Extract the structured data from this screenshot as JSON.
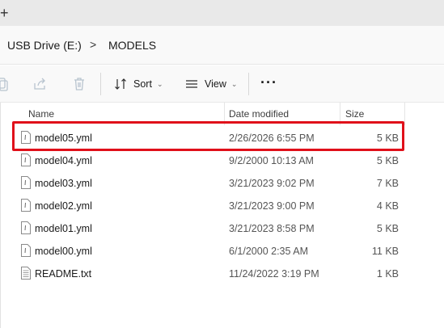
{
  "titlebar": {
    "new_tab_symbol": "+"
  },
  "address": {
    "crumbs": [
      "USB Drive (E:)",
      "MODELS"
    ],
    "separator": ">"
  },
  "toolbar": {
    "sort_label": "Sort",
    "view_label": "View",
    "more_label": "···"
  },
  "columns": {
    "name": "Name",
    "date": "Date modified",
    "size": "Size"
  },
  "files": [
    {
      "name": "model05.yml",
      "date": "2/26/2026 6:55 PM",
      "size": "5 KB",
      "icon": "yml-file-icon",
      "selected": true
    },
    {
      "name": "model04.yml",
      "date": "9/2/2000 10:13 AM",
      "size": "5 KB",
      "icon": "yml-file-icon"
    },
    {
      "name": "model03.yml",
      "date": "3/21/2023 9:02 PM",
      "size": "7 KB",
      "icon": "yml-file-icon"
    },
    {
      "name": "model02.yml",
      "date": "3/21/2023 9:00 PM",
      "size": "4 KB",
      "icon": "yml-file-icon"
    },
    {
      "name": "model01.yml",
      "date": "3/21/2023 8:58 PM",
      "size": "5 KB",
      "icon": "yml-file-icon"
    },
    {
      "name": "model00.yml",
      "date": "6/1/2000 2:35 AM",
      "size": "11 KB",
      "icon": "yml-file-icon"
    },
    {
      "name": "README.txt",
      "date": "11/24/2022 3:19 PM",
      "size": "1 KB",
      "icon": "text-file-icon"
    }
  ],
  "colors": {
    "highlight": "#e0101a",
    "titlebar": "#e9e9e9",
    "addressbar": "#f9f9f9"
  }
}
